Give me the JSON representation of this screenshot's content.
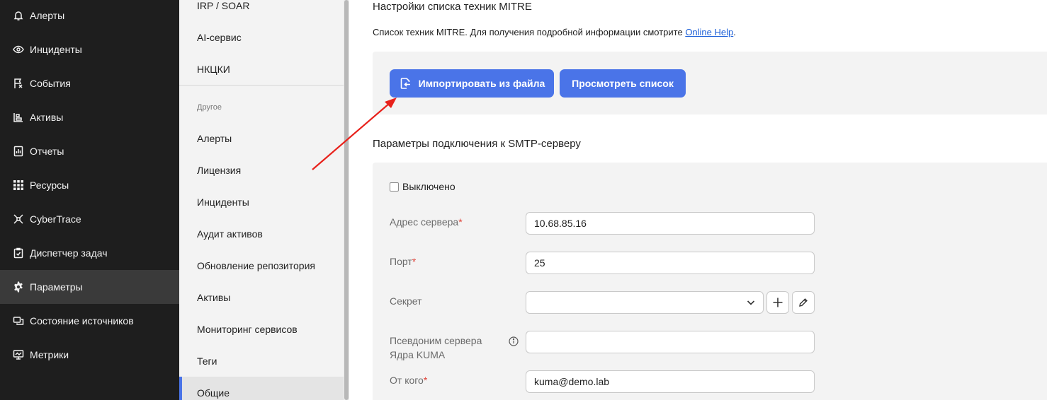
{
  "nav": {
    "items": [
      {
        "label": "Алерты",
        "icon": "bell-icon"
      },
      {
        "label": "Инциденты",
        "icon": "eye-icon"
      },
      {
        "label": "События",
        "icon": "flag-icon"
      },
      {
        "label": "Активы",
        "icon": "assets-icon"
      },
      {
        "label": "Отчеты",
        "icon": "report-icon"
      },
      {
        "label": "Ресурсы",
        "icon": "grid-icon"
      },
      {
        "label": "CyberTrace",
        "icon": "cybertrace-icon"
      },
      {
        "label": "Диспетчер задач",
        "icon": "task-icon"
      },
      {
        "label": "Параметры",
        "icon": "gear-icon"
      },
      {
        "label": "Состояние источников",
        "icon": "source-icon"
      },
      {
        "label": "Метрики",
        "icon": "metrics-icon"
      }
    ],
    "active": "Параметры"
  },
  "submenu": {
    "top_items": [
      "IRP / SOAR",
      "AI-сервис",
      "НКЦКИ"
    ],
    "group_label": "Другое",
    "group_items": [
      "Алерты",
      "Лицензия",
      "Инциденты",
      "Аудит активов",
      "Обновление репозитория",
      "Активы",
      "Мониторинг сервисов",
      "Теги",
      "Общие"
    ],
    "active": "Общие"
  },
  "mitre": {
    "title": "Настройки списка техник MITRE",
    "description": "Список техник MITRE. Для получения подробной информации смотрите ",
    "help_link": "Online Help",
    "description_end": ".",
    "import_button": "Импортировать из файла",
    "view_button": "Просмотреть список"
  },
  "smtp": {
    "title": "Параметры подключения к SMTP-серверу",
    "disabled_label": "Выключено",
    "disabled_checked": false,
    "server_address_label": "Адрес сервера",
    "server_address_value": "10.68.85.16",
    "port_label": "Порт",
    "port_value": "25",
    "secret_label": "Секрет",
    "secret_value": "",
    "alias_label": "Псевдоним сервера Ядра KUMA",
    "alias_value": "",
    "from_label": "От кого",
    "from_value": "kuma@demo.lab",
    "required_mark": "*"
  },
  "colors": {
    "accent": "#4a74e8",
    "nav_bg": "#1e1e1e",
    "annotation_arrow": "#e8211b"
  }
}
